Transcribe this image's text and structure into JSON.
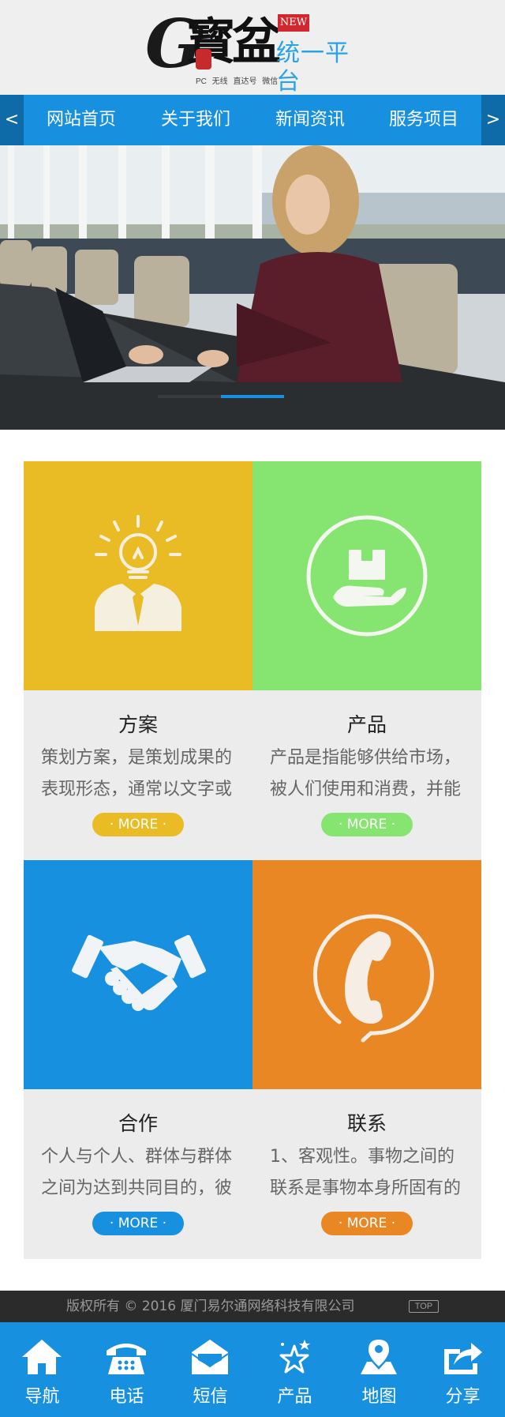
{
  "header": {
    "logo_letter": "G",
    "logo_chars": "寳盆",
    "badge": "NEW",
    "platform": "统一平台",
    "subtitle": "PC 无线 直达号 微信"
  },
  "nav": {
    "prev": "<",
    "next": ">",
    "items": [
      "网站首页",
      "关于我们",
      "新闻资讯",
      "服务项目"
    ]
  },
  "colors": {
    "primary": "#1890e0",
    "yellow": "#e9bb24",
    "green": "#86e471",
    "blue": "#1890e0",
    "orange": "#e88724"
  },
  "cards": [
    {
      "title": "方案",
      "desc": "策划方案，是策划成果的表现形态，通常以文字或",
      "more": "· MORE ·",
      "icon": "lightbulb-person-icon"
    },
    {
      "title": "产品",
      "desc": "产品是指能够供给市场，被人们使用和消费，并能",
      "more": "· MORE ·",
      "icon": "hand-box-icon"
    },
    {
      "title": "合作",
      "desc": "个人与个人、群体与群体之间为达到共同目的，彼",
      "more": "· MORE ·",
      "icon": "handshake-icon"
    },
    {
      "title": "联系",
      "desc": "1、客观性。事物之间的联系是事物本身所固有的",
      "more": "· MORE ·",
      "icon": "phone-circle-icon"
    }
  ],
  "footer": {
    "copyright": "版权所有 © 2016 厦门易尔通网络科技有限公司",
    "top": "TOP"
  },
  "bottom_nav": [
    {
      "label": "导航",
      "icon": "home-icon"
    },
    {
      "label": "电话",
      "icon": "telephone-icon"
    },
    {
      "label": "短信",
      "icon": "envelope-icon"
    },
    {
      "label": "产品",
      "icon": "stars-icon"
    },
    {
      "label": "地图",
      "icon": "map-pin-icon"
    },
    {
      "label": "分享",
      "icon": "share-icon"
    }
  ]
}
